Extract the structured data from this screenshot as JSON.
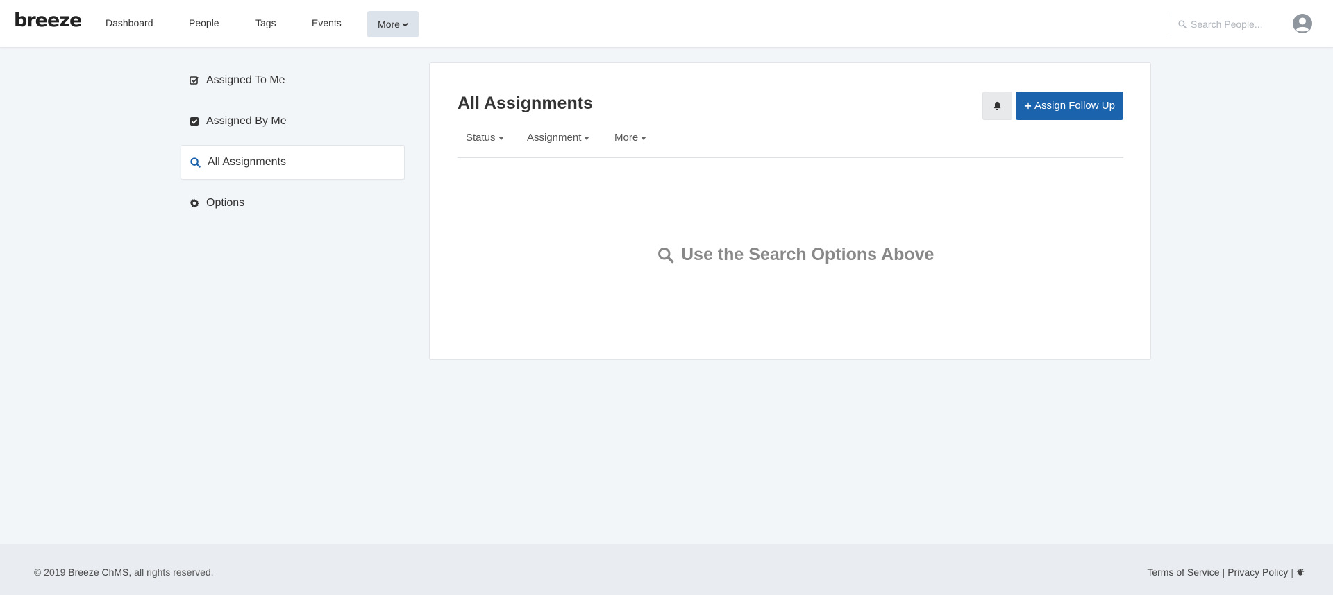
{
  "brand": {
    "logo": "breeze"
  },
  "nav": {
    "items": [
      {
        "label": "Dashboard"
      },
      {
        "label": "People"
      },
      {
        "label": "Tags"
      },
      {
        "label": "Events"
      }
    ],
    "more_label": "More",
    "search_placeholder": "Search People..."
  },
  "sidebar": {
    "items": [
      {
        "label": "Assigned To Me",
        "icon": "checkbox-outline-icon"
      },
      {
        "label": "Assigned By Me",
        "icon": "checkbox-checked-icon"
      },
      {
        "label": "All Assignments",
        "icon": "search-icon",
        "active": true
      },
      {
        "label": "Options",
        "icon": "gear-icon"
      }
    ]
  },
  "main": {
    "title": "All Assignments",
    "assign_button": "Assign Follow Up",
    "filters": [
      {
        "label": "Status"
      },
      {
        "label": "Assignment"
      },
      {
        "label": "More"
      }
    ],
    "empty_message": "Use the Search Options Above"
  },
  "footer": {
    "copyright_prefix": "© 2019 ",
    "brand": "Breeze ChMS",
    "copyright_suffix": ", all rights reserved.",
    "terms": "Terms of Service",
    "privacy": "Privacy Policy",
    "separator": "|"
  },
  "colors": {
    "primary": "#1b63ad",
    "background": "#f3f6f9",
    "accent_icon": "#1b63ad"
  }
}
